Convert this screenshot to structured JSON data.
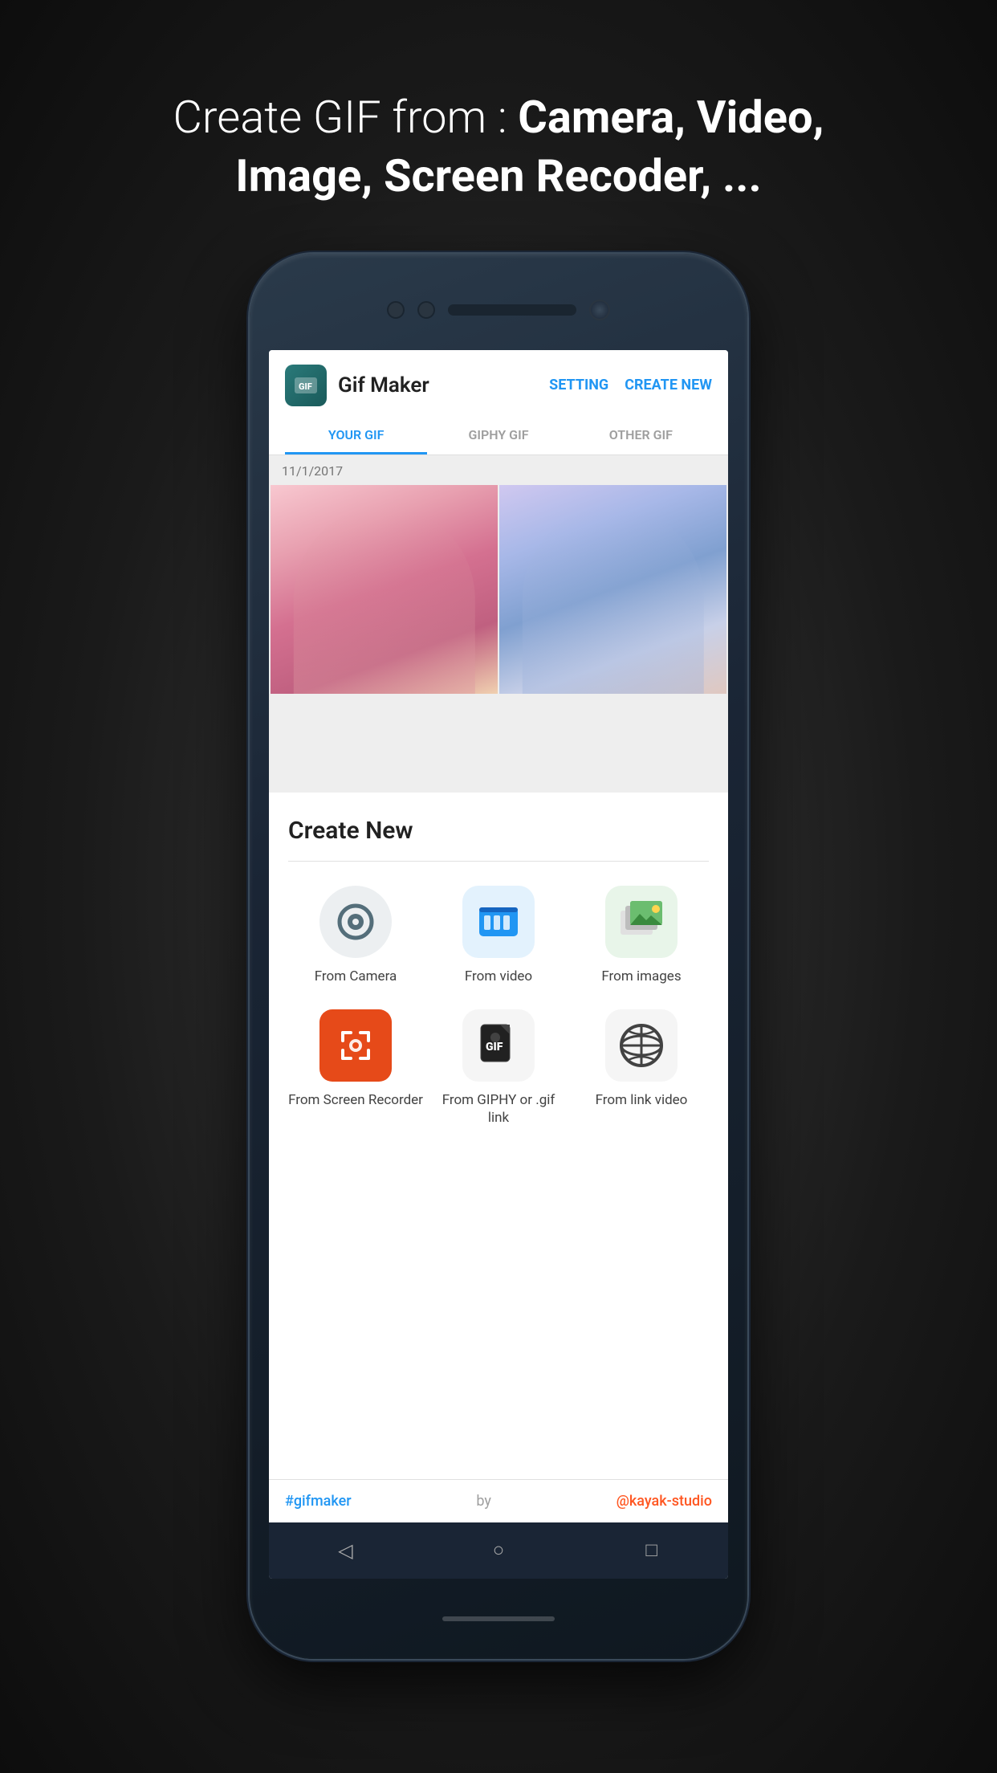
{
  "headline": {
    "line1": "Create GIF from : ",
    "line2_bold": "Camera, Video,",
    "line3_bold": "Image, Screen Recoder, ..."
  },
  "app": {
    "logo_text": "GIF",
    "title": "Gif Maker",
    "setting_btn": "SETTING",
    "create_new_btn": "CREATE NEW",
    "tabs": [
      {
        "label": "YOUR GIF",
        "active": true
      },
      {
        "label": "GIPHY GIF",
        "active": false
      },
      {
        "label": "OTHER GIF",
        "active": false
      }
    ],
    "date_label": "11/1/2017"
  },
  "create_new": {
    "title": "Create New",
    "options": [
      {
        "id": "camera",
        "label": "From Camera",
        "type": "camera"
      },
      {
        "id": "video",
        "label": "From video",
        "type": "video"
      },
      {
        "id": "images",
        "label": "From images",
        "type": "images"
      },
      {
        "id": "screen",
        "label": "From Screen Recorder",
        "type": "screen"
      },
      {
        "id": "giphy",
        "label": "From GIPHY or .gif link",
        "type": "giphy"
      },
      {
        "id": "link",
        "label": "From link video",
        "type": "link"
      }
    ]
  },
  "footer": {
    "hashtag": "#gifmaker",
    "by": "by",
    "studio": "@kayak-studio"
  },
  "nav": {
    "back_icon": "◁",
    "home_icon": "○",
    "square_icon": "□"
  }
}
